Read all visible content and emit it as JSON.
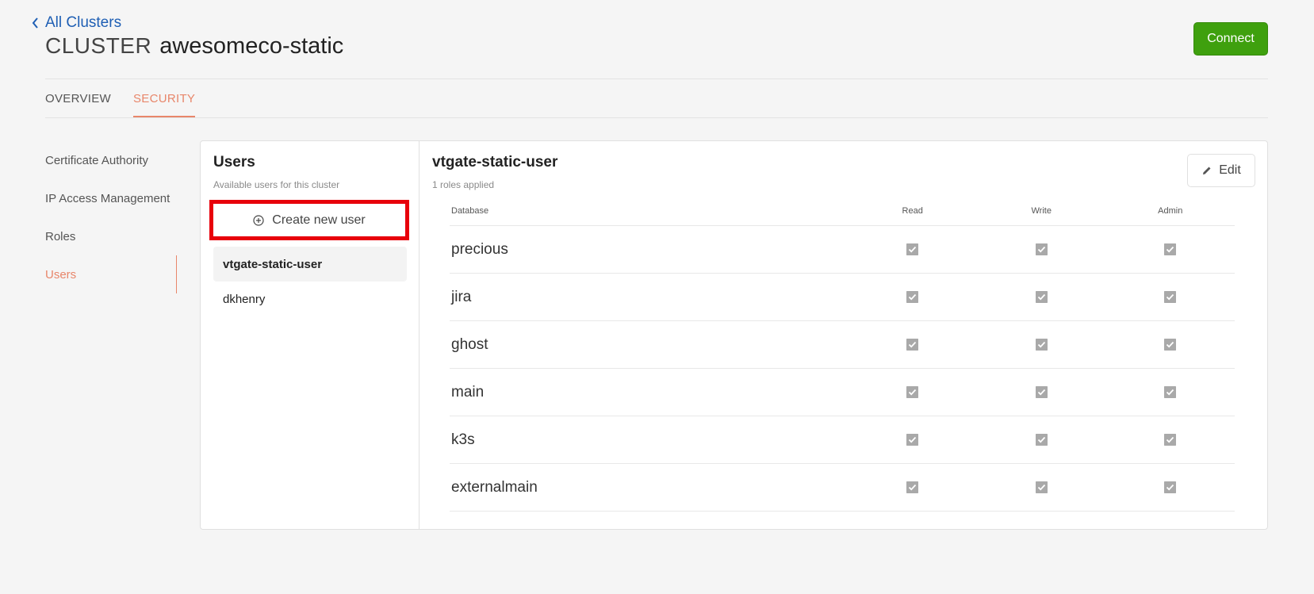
{
  "nav": {
    "back_label": "All Clusters"
  },
  "cluster": {
    "prefix": "CLUSTER",
    "name": "awesomeco-static"
  },
  "actions": {
    "connect_label": "Connect"
  },
  "tabs": [
    {
      "label": "OVERVIEW",
      "active": false
    },
    {
      "label": "SECURITY",
      "active": true
    }
  ],
  "sidebar": {
    "items": [
      {
        "label": "Certificate Authority",
        "active": false
      },
      {
        "label": "IP Access Management",
        "active": false
      },
      {
        "label": "Roles",
        "active": false
      },
      {
        "label": "Users",
        "active": true
      }
    ]
  },
  "users_panel": {
    "title": "Users",
    "subtitle": "Available users for this cluster",
    "create_label": "Create new user",
    "users": [
      {
        "name": "vtgate-static-user",
        "selected": true
      },
      {
        "name": "dkhenry",
        "selected": false
      }
    ]
  },
  "detail": {
    "title": "vtgate-static-user",
    "subtitle": "1 roles applied",
    "edit_label": "Edit",
    "columns": [
      "Database",
      "Read",
      "Write",
      "Admin"
    ],
    "rows": [
      {
        "database": "precious",
        "read": true,
        "write": true,
        "admin": true
      },
      {
        "database": "jira",
        "read": true,
        "write": true,
        "admin": true
      },
      {
        "database": "ghost",
        "read": true,
        "write": true,
        "admin": true
      },
      {
        "database": "main",
        "read": true,
        "write": true,
        "admin": true
      },
      {
        "database": "k3s",
        "read": true,
        "write": true,
        "admin": true
      },
      {
        "database": "externalmain",
        "read": true,
        "write": true,
        "admin": true
      }
    ]
  },
  "colors": {
    "link": "#1f5fb4",
    "accent": "#e8866a",
    "connect_bg": "#3fa00e",
    "highlight_border": "#e8000b"
  }
}
